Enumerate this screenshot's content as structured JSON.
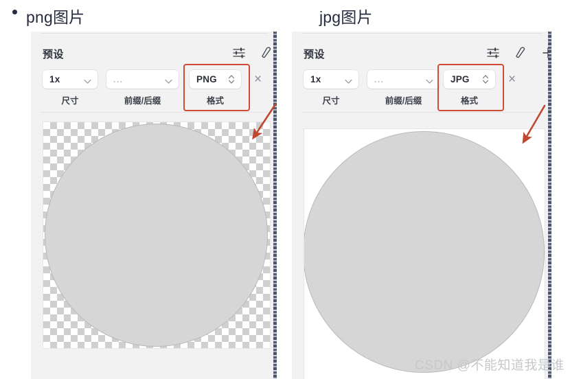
{
  "headings": {
    "left": "png图片",
    "right": "jpg图片"
  },
  "panels": [
    {
      "id": "png-panel",
      "preset_label": "预设",
      "icons": [
        "sliders-icon",
        "pen-icon",
        "plus-icon"
      ],
      "controls": {
        "size": {
          "value": "1x",
          "label": "尺寸"
        },
        "affix": {
          "value": "...",
          "label": "前缀/后缀"
        },
        "format": {
          "value": "PNG",
          "label": "格式"
        },
        "close": "×"
      },
      "preview": {
        "background": "checkerboard-transparent",
        "shape": "circle"
      }
    },
    {
      "id": "jpg-panel",
      "preset_label": "预设",
      "icons": [
        "sliders-icon",
        "pen-icon",
        "plus-icon"
      ],
      "controls": {
        "size": {
          "value": "1x",
          "label": "尺寸"
        },
        "affix": {
          "value": "...",
          "label": "前缀/后缀"
        },
        "format": {
          "value": "JPG",
          "label": "格式"
        },
        "close": "×"
      },
      "preview": {
        "background": "white-opaque",
        "shape": "circle"
      }
    }
  ],
  "annotations": {
    "highlight_color": "#cf4b35",
    "arrow_color": "#c0462f",
    "arrow_count": 2
  },
  "watermark": "CSDN @不能知道我是谁",
  "colors": {
    "panel_bg": "#f2f2f2",
    "circle_fill": "#d6d6d6",
    "heading_text": "#262b3f"
  }
}
